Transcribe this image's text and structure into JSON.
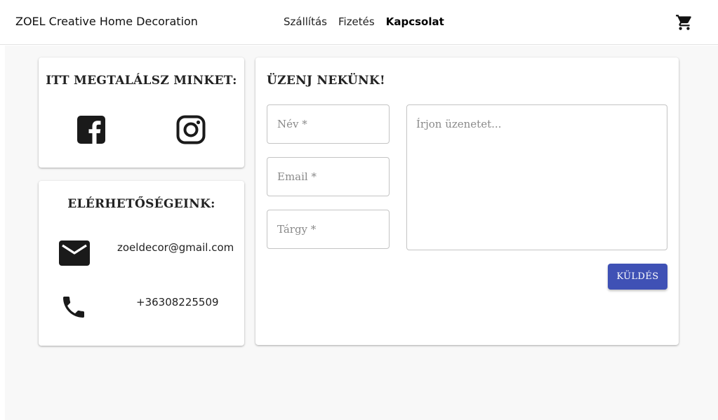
{
  "header": {
    "brand": "ZOEL Creative Home Decoration",
    "nav": [
      {
        "label": "Szállítás"
      },
      {
        "label": "Fizetés"
      },
      {
        "label": "Kapcsolat"
      }
    ],
    "cart_icon": "shopping-cart-icon"
  },
  "social": {
    "title": "ITT MEGTALÁLSZ MINKET:",
    "icons": [
      "facebook-icon",
      "instagram-icon"
    ]
  },
  "contact": {
    "title": "ELÉRHETŐSÉGEINK:",
    "email": "zoeldecor@gmail.com",
    "phone": "+36308225509",
    "icons": [
      "mail-icon",
      "phone-icon"
    ]
  },
  "form": {
    "title": "ÜZENJ NEKÜNK!",
    "name_placeholder": "Név *",
    "email_placeholder": "Email *",
    "subject_placeholder": "Tárgy *",
    "message_placeholder": "Írjon üzenetet...",
    "submit_label": "KÜLDÉS"
  },
  "colors": {
    "primary": "#3f51b5",
    "background": "#f8f8f8"
  }
}
